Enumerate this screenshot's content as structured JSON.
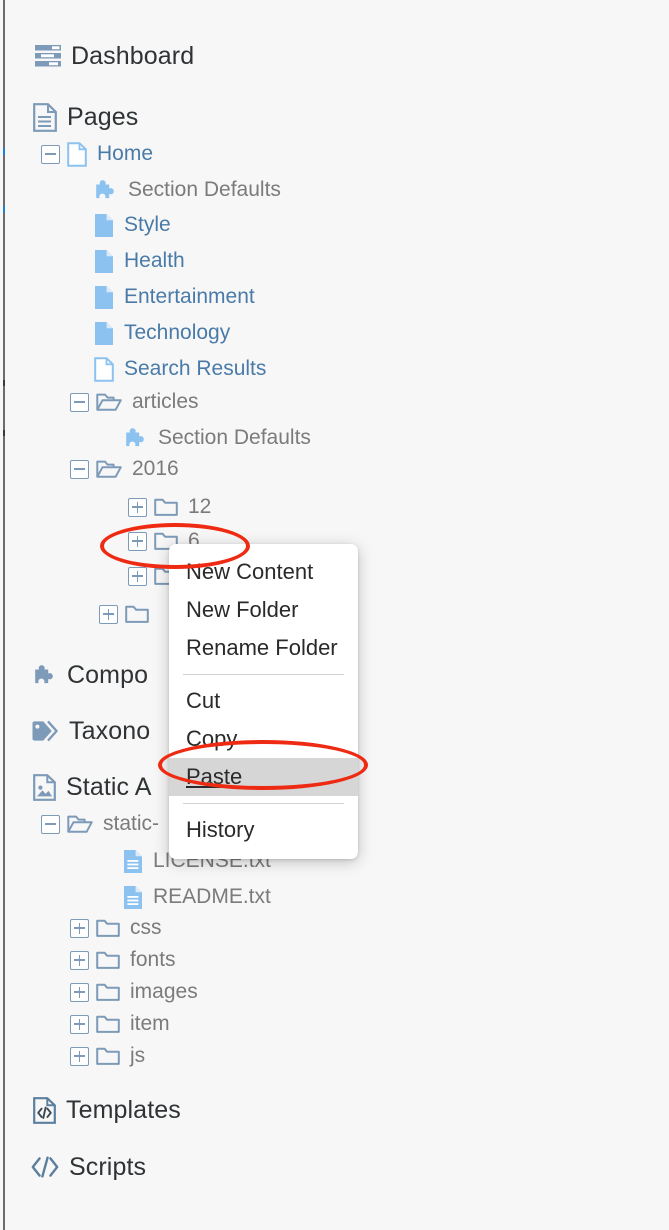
{
  "app": {
    "background": "#f7f7f7",
    "accent_blue": "#4a7ba8",
    "icon_blue": "#7d9ab8",
    "page_icon_blue": "#8bc2f0",
    "annotation_color": "#ee2b12"
  },
  "sidebar": {
    "nav": [
      {
        "label": "Dashboard",
        "icon": "dashboard-icon"
      },
      {
        "label": "Pages",
        "icon": "pages-document-icon"
      },
      {
        "label": "Compo",
        "full_label": "Components",
        "icon": "puzzle-piece-icon",
        "truncated": true
      },
      {
        "label": "Taxono",
        "full_label": "Taxonomy",
        "icon": "tag-icon",
        "truncated": true
      },
      {
        "label": "Static A",
        "full_label": "Static Assets",
        "icon": "image-document-icon",
        "truncated": true
      },
      {
        "label": "Templates",
        "icon": "template-code-document-icon"
      },
      {
        "label": "Scripts",
        "icon": "code-brackets-icon"
      }
    ],
    "pages_tree": [
      {
        "label": "Home",
        "icon": "page-outline-icon",
        "toggle": "minus",
        "indent": 1,
        "tone": "blue"
      },
      {
        "label": "Section Defaults",
        "icon": "puzzle-piece-icon",
        "toggle": "none",
        "indent": 2,
        "tone": "grey"
      },
      {
        "label": "Style",
        "icon": "page-filled-icon",
        "toggle": "none",
        "indent": 2,
        "tone": "blue"
      },
      {
        "label": "Health",
        "icon": "page-filled-icon",
        "toggle": "none",
        "indent": 2,
        "tone": "blue"
      },
      {
        "label": "Entertainment",
        "icon": "page-filled-icon",
        "toggle": "none",
        "indent": 2,
        "tone": "blue"
      },
      {
        "label": "Technology",
        "icon": "page-filled-icon",
        "toggle": "none",
        "indent": 2,
        "tone": "blue"
      },
      {
        "label": "Search Results",
        "icon": "page-outline-icon",
        "toggle": "none",
        "indent": 2,
        "tone": "blue"
      },
      {
        "label": "articles",
        "icon": "folder-open-icon",
        "toggle": "minus",
        "indent": 2,
        "tone": "grey"
      },
      {
        "label": "Section Defaults",
        "icon": "puzzle-piece-icon",
        "toggle": "none",
        "indent": 3,
        "tone": "grey"
      },
      {
        "label": "2016",
        "icon": "folder-open-icon",
        "toggle": "minus",
        "indent": 3,
        "tone": "grey"
      },
      {
        "label": "12",
        "icon": "folder-closed-icon",
        "toggle": "plus",
        "indent": 4,
        "tone": "grey"
      },
      {
        "label": "6",
        "icon": "folder-closed-icon",
        "toggle": "plus",
        "indent": 4,
        "tone": "grey"
      },
      {
        "label": "",
        "icon": "folder-closed-icon",
        "toggle": "plus",
        "indent": 4,
        "tone": "grey"
      },
      {
        "label": "",
        "icon": "folder-closed-icon",
        "toggle": "plus",
        "indent": 3,
        "tone": "grey"
      }
    ],
    "static_assets_tree": [
      {
        "label": "static-",
        "full_label": "static-assets",
        "icon": "folder-open-icon",
        "toggle": "minus",
        "indent": 1,
        "tone": "grey",
        "truncated": true
      },
      {
        "label": "LICENSE.txt",
        "icon": "text-file-icon",
        "toggle": "none",
        "indent": 2,
        "tone": "grey"
      },
      {
        "label": "README.txt",
        "icon": "text-file-icon",
        "toggle": "none",
        "indent": 2,
        "tone": "grey"
      },
      {
        "label": "css",
        "icon": "folder-closed-icon",
        "toggle": "plus",
        "indent": 1,
        "tone": "grey"
      },
      {
        "label": "fonts",
        "icon": "folder-closed-icon",
        "toggle": "plus",
        "indent": 1,
        "tone": "grey"
      },
      {
        "label": "images",
        "icon": "folder-closed-icon",
        "toggle": "plus",
        "indent": 1,
        "tone": "grey"
      },
      {
        "label": "item",
        "icon": "folder-closed-icon",
        "toggle": "plus",
        "indent": 1,
        "tone": "grey"
      },
      {
        "label": "js",
        "icon": "folder-closed-icon",
        "toggle": "plus",
        "indent": 1,
        "tone": "grey"
      }
    ]
  },
  "context_menu": {
    "items": [
      {
        "label": "New Content",
        "selected": false
      },
      {
        "label": "New Folder",
        "selected": false
      },
      {
        "label": "Rename Folder",
        "selected": false
      },
      {
        "separator": true
      },
      {
        "label": "Cut",
        "selected": false
      },
      {
        "label": "Copy",
        "selected": false
      },
      {
        "label": "Paste",
        "selected": true
      },
      {
        "separator": true
      },
      {
        "label": "History",
        "selected": false
      }
    ]
  },
  "annotations": [
    {
      "name": "highlight-folder-6-row",
      "shape": "ellipse"
    },
    {
      "name": "highlight-paste-menu-item",
      "shape": "ellipse"
    }
  ]
}
